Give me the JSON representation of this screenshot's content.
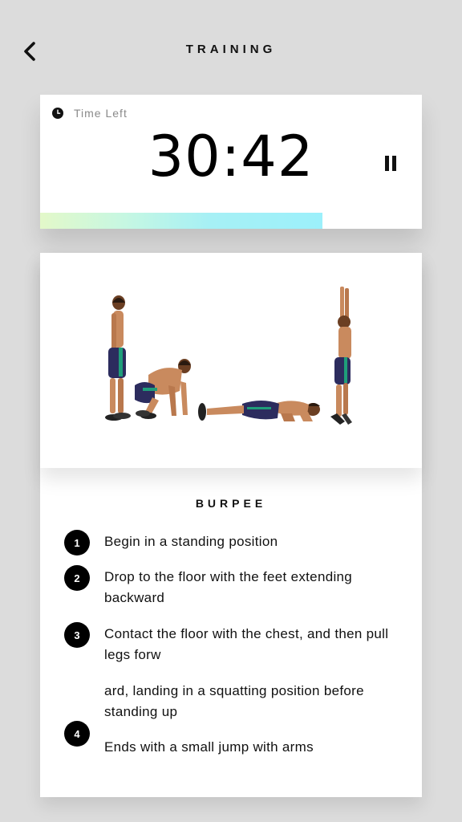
{
  "header": {
    "title": "TRAINING"
  },
  "timer": {
    "label": "Time Left",
    "value": "30:42",
    "progress": 0.74
  },
  "exercise": {
    "name": "BURPEE",
    "steps": [
      {
        "num": "1",
        "text": "Begin in a standing position"
      },
      {
        "num": "2",
        "text": "Drop to the floor with the feet extending backward"
      },
      {
        "num": "3",
        "text": "Contact the floor with the chest, and then pull legs forw"
      },
      {
        "num": "",
        "text": "ard, landing in a squatting position before standing up"
      },
      {
        "num": "4",
        "text": "Ends with a small jump with arms"
      }
    ]
  },
  "colors": {
    "background": "#dcdcdc",
    "card": "#ffffff",
    "progress_start": "#e3f8c9",
    "progress_end": "#9cf0fb"
  }
}
